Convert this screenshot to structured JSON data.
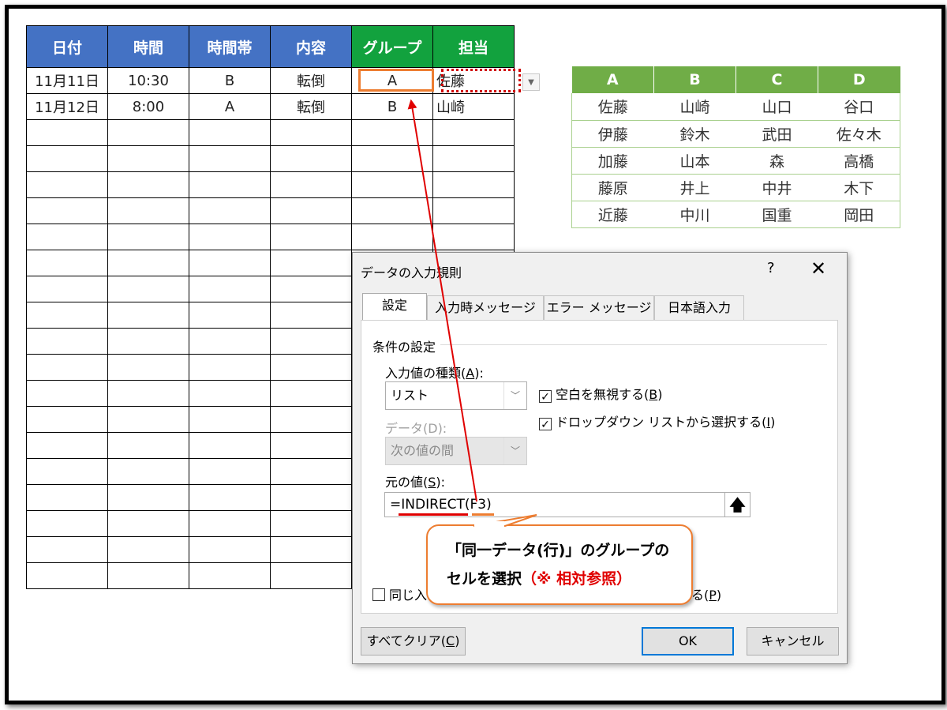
{
  "sheet": {
    "headers": [
      "日付",
      "時間",
      "時間帯",
      "内容",
      "グループ",
      "担当"
    ],
    "rows": [
      [
        "11月11日",
        "10:30",
        "B",
        "転倒",
        "A",
        "佐藤"
      ],
      [
        "11月12日",
        "8:00",
        "A",
        "転倒",
        "B",
        "山崎"
      ]
    ]
  },
  "list": {
    "headers": [
      "A",
      "B",
      "C",
      "D"
    ],
    "rows": [
      [
        "佐藤",
        "山崎",
        "山口",
        "谷口"
      ],
      [
        "伊藤",
        "鈴木",
        "武田",
        "佐々木"
      ],
      [
        "加藤",
        "山本",
        "森",
        "高橋"
      ],
      [
        "藤原",
        "井上",
        "中井",
        "木下"
      ],
      [
        "近藤",
        "中川",
        "国重",
        "岡田"
      ]
    ]
  },
  "dialog": {
    "title": "データの入力規則",
    "help": "?",
    "close": "✕",
    "tabs": [
      "設定",
      "入力時メッセージ",
      "エラー メッセージ",
      "日本語入力"
    ],
    "group_label": "条件の設定",
    "allow_label_pre": "入力値の種類(",
    "allow_label_key": "A",
    "allow_label_post": "):",
    "allow_value": "リスト",
    "data_label": "データ(D):",
    "data_value": "次の値の間",
    "ignore_blank_pre": "空白を無視する(",
    "ignore_blank_key": "B",
    "ignore_blank_post": ")",
    "dropdown_pre": "ドロップダウン リストから選択する(",
    "dropdown_key": "I",
    "dropdown_post": ")",
    "source_label_pre": "元の値(",
    "source_label_key": "S",
    "source_label_post": "):",
    "source_value": "=INDIRECT(F3)",
    "apply_pre": "同じ入",
    "apply_tail_pre": "る(",
    "apply_tail_key": "P",
    "apply_tail_post": ")",
    "clear_pre": "すべてクリア(",
    "clear_key": "C",
    "clear_post": ")",
    "ok": "OK",
    "cancel": "キャンセル"
  },
  "callout": {
    "line1": "「同一データ(行)」のグループの",
    "line2": "セルを選択",
    "note": "（※ 相対参照）"
  },
  "colors": {
    "header_blue": "#4472c4",
    "header_green": "#12a23e",
    "list_green": "#70ad47",
    "highlight_orange": "#ed7d31",
    "arrow_red": "#e00000"
  },
  "icons": {
    "dropdown": "chevron-down-icon",
    "collapse": "upload-arrow-icon",
    "check": "check-icon"
  }
}
